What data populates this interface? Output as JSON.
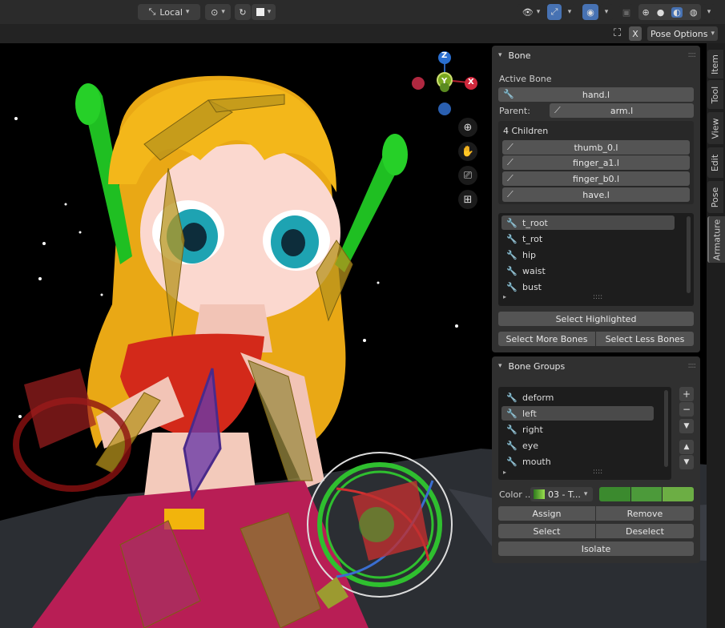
{
  "header": {
    "transform_orientation": "Local",
    "pose_options_label": "Pose Options",
    "x_toggle": "X"
  },
  "tabs": [
    "Item",
    "Tool",
    "View",
    "Edit",
    "Pose",
    "Armature"
  ],
  "gizmo": {
    "z": "Z",
    "x": "X",
    "y": "Y"
  },
  "bone_panel": {
    "title": "Bone",
    "active_bone_label": "Active Bone",
    "active_bone_value": "hand.l",
    "parent_label": "Parent:",
    "parent_value": "arm.l",
    "children_label": "4 Children",
    "children": [
      "thumb_0.l",
      "finger_a1.l",
      "finger_b0.l",
      "have.l"
    ],
    "bone_list": [
      "t_root",
      "t_rot",
      "hip",
      "waist",
      "bust"
    ],
    "select_highlighted": "Select Highlighted",
    "select_more": "Select More Bones",
    "select_less": "Select Less Bones"
  },
  "groups_panel": {
    "title": "Bone Groups",
    "groups": [
      "deform",
      "left",
      "right",
      "eye",
      "mouth"
    ],
    "color_label": "Color ...",
    "color_set": "03 - T...",
    "color_swatches": [
      "#3b8a2e",
      "#4c9a3a",
      "#6cae44"
    ],
    "assign": "Assign",
    "remove": "Remove",
    "select": "Select",
    "deselect": "Deselect",
    "isolate": "Isolate"
  },
  "colors": {
    "accent_blue": "#4772b3",
    "hair": "#f0b418",
    "headphones": "#22c022",
    "top": "#d02a1a",
    "pants": "#b81e55"
  }
}
